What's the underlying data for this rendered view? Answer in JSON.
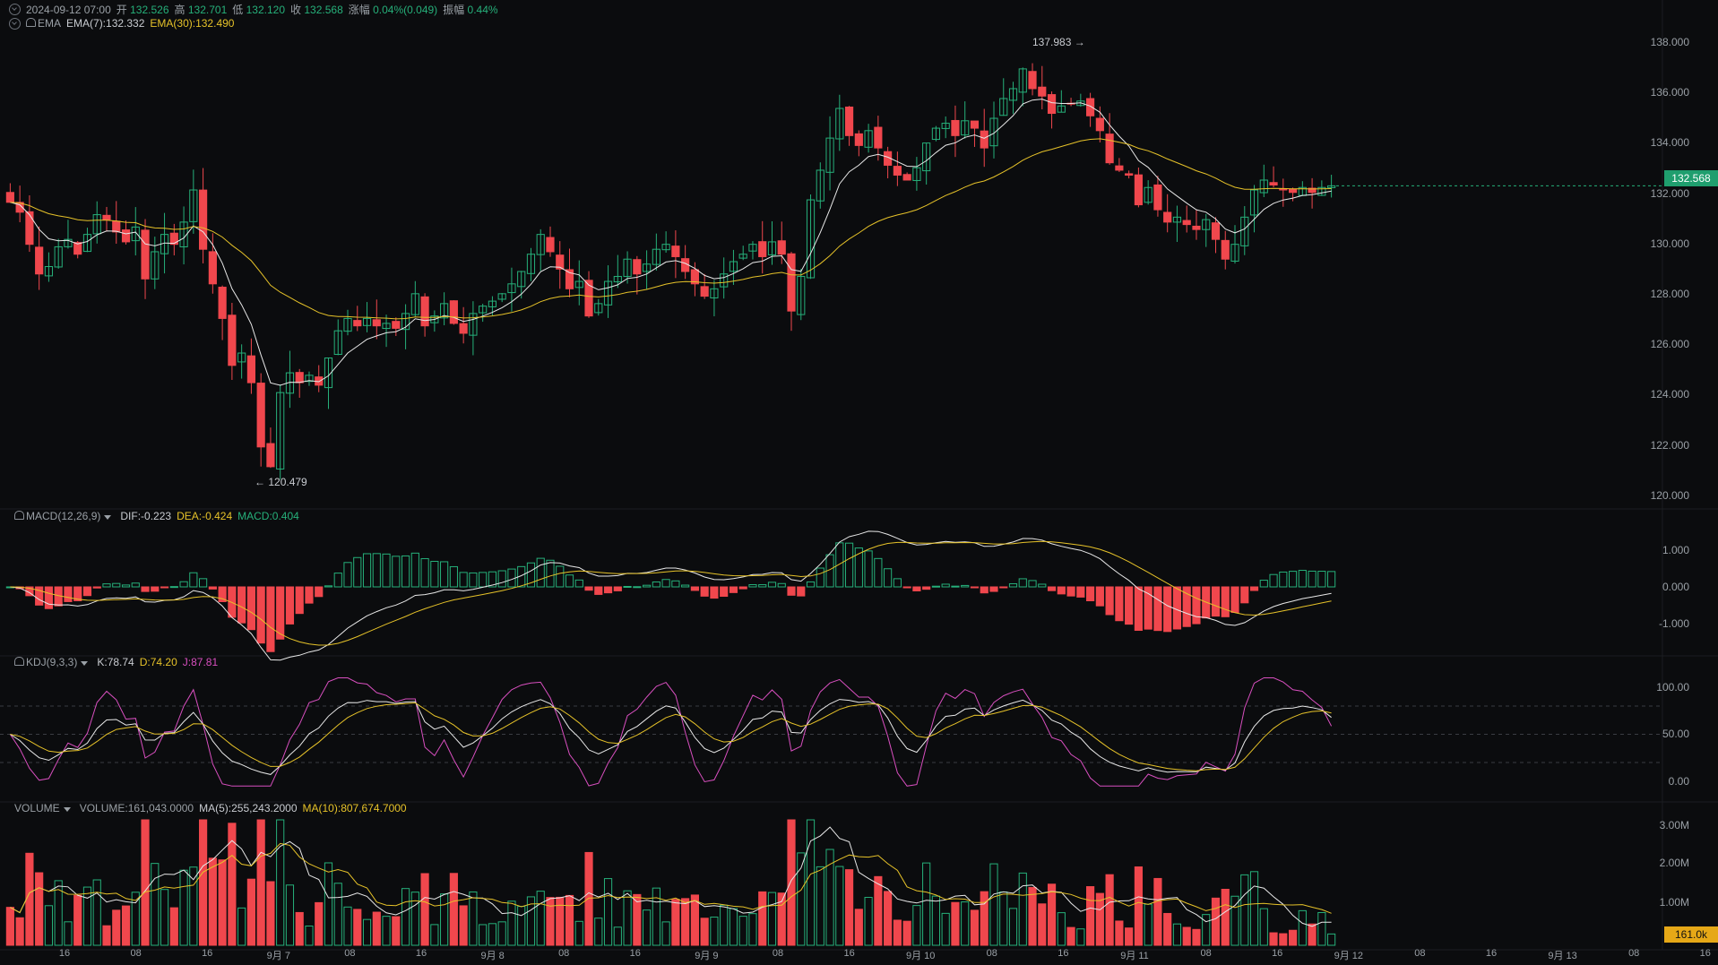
{
  "ohlc_header": {
    "datetime": "2024-09-12 07:00",
    "open_label": "开",
    "open": "132.526",
    "high_label": "高",
    "high": "132.701",
    "low_label": "低",
    "low": "132.120",
    "close_label": "收",
    "close": "132.568",
    "change_label": "涨幅",
    "change": "0.04%(0.049)",
    "amplitude_label": "振幅",
    "amplitude": "0.44%"
  },
  "ema_header": {
    "name": "EMA",
    "ema7": "EMA(7):132.332",
    "ema30": "EMA(30):132.490"
  },
  "macd_header": {
    "name": "MACD(12,26,9)",
    "dif": "DIF:-0.223",
    "dea": "DEA:-0.424",
    "macd": "MACD:0.404"
  },
  "kdj_header": {
    "name": "KDJ(9,3,3)",
    "k": "K:78.74",
    "d": "D:74.20",
    "j": "J:87.81"
  },
  "volume_header": {
    "name": "VOLUME",
    "volume": "VOLUME:161,043.0000",
    "ma5": "MA(5):255,243.2000",
    "ma10": "MA(10):807,674.7000"
  },
  "price_axis": [
    "138.000",
    "136.000",
    "134.000",
    "132.000",
    "130.000",
    "128.000",
    "126.000",
    "124.000",
    "122.000",
    "120.000"
  ],
  "macd_axis": [
    "1.000",
    "0.000",
    "-1.000"
  ],
  "kdj_axis": [
    "100.00",
    "50.00",
    "0.00"
  ],
  "volume_axis": [
    "3.00M",
    "2.00M",
    "1.00M"
  ],
  "current_price_tag": "132.568",
  "current_volume_tag": "161.0k",
  "high_marker": "137.983",
  "low_marker": "120.479",
  "time_axis": [
    "16",
    "08",
    "16",
    "9月 7",
    "08",
    "16",
    "9月 8",
    "08",
    "16",
    "9月 9",
    "08",
    "16",
    "9月 10",
    "08",
    "16",
    "9月 11",
    "08",
    "16",
    "9月 12",
    "08",
    "16",
    "9月 13",
    "08",
    "16"
  ],
  "colors": {
    "up": "#26b07a",
    "down": "#f0474d",
    "ema7": "#e8e8e8",
    "ema30": "#e6c229",
    "j": "#d84fbf",
    "bg": "#0b0c0e"
  },
  "chart_data": {
    "type": "candlestick",
    "close_series": [
      131.9,
      131.5,
      130.2,
      129.0,
      129.3,
      130.1,
      130.4,
      129.8,
      130.6,
      131.4,
      131.2,
      130.7,
      130.3,
      130.9,
      128.8,
      129.9,
      130.6,
      130.2,
      131.1,
      132.4,
      130.0,
      128.6,
      127.2,
      125.3,
      125.8,
      124.6,
      122.0,
      121.2,
      124.2,
      125.0,
      124.6,
      124.9,
      124.5,
      125.6,
      126.7,
      127.2,
      126.9,
      127.2,
      126.9,
      127.0,
      126.8,
      127.4,
      128.2,
      126.9,
      127.3,
      127.8,
      127.0,
      126.6,
      127.4,
      127.7,
      127.9,
      128.2,
      128.6,
      129.1,
      129.8,
      130.6,
      129.9,
      129.2,
      128.4,
      128.7,
      127.3,
      127.8,
      128.7,
      128.9,
      129.6,
      129.0,
      129.4,
      130.0,
      130.2,
      129.7,
      129.1,
      128.6,
      128.1,
      128.4,
      129.0,
      129.5,
      129.8,
      130.2,
      129.7,
      130.3,
      129.8,
      127.5,
      128.9,
      132.0,
      133.2,
      134.5,
      135.7,
      134.6,
      134.2,
      134.8,
      134.1,
      133.4,
      133.0,
      132.8,
      133.3,
      134.3,
      134.9,
      135.1,
      134.6,
      135.2,
      134.9,
      134.1,
      135.3,
      136.1,
      136.5,
      137.3,
      136.5,
      136.2,
      135.5,
      135.8,
      135.9,
      136.0,
      135.4,
      134.8,
      133.5,
      133.2,
      133.0,
      131.8,
      132.5,
      131.6,
      131.1,
      131.3,
      131.0,
      130.8,
      131.2,
      130.4,
      129.6,
      130.2,
      131.3,
      132.4,
      132.8,
      132.6,
      132.4,
      132.3,
      132.5,
      132.3,
      132.5,
      132.568
    ],
    "price_range": [
      119.6,
      139.0
    ],
    "ema_periods": [
      7,
      30
    ],
    "macd_params": [
      12,
      26,
      9
    ],
    "kdj_params": [
      9,
      3,
      3
    ],
    "kdj_levels": [
      20,
      50,
      80
    ]
  }
}
